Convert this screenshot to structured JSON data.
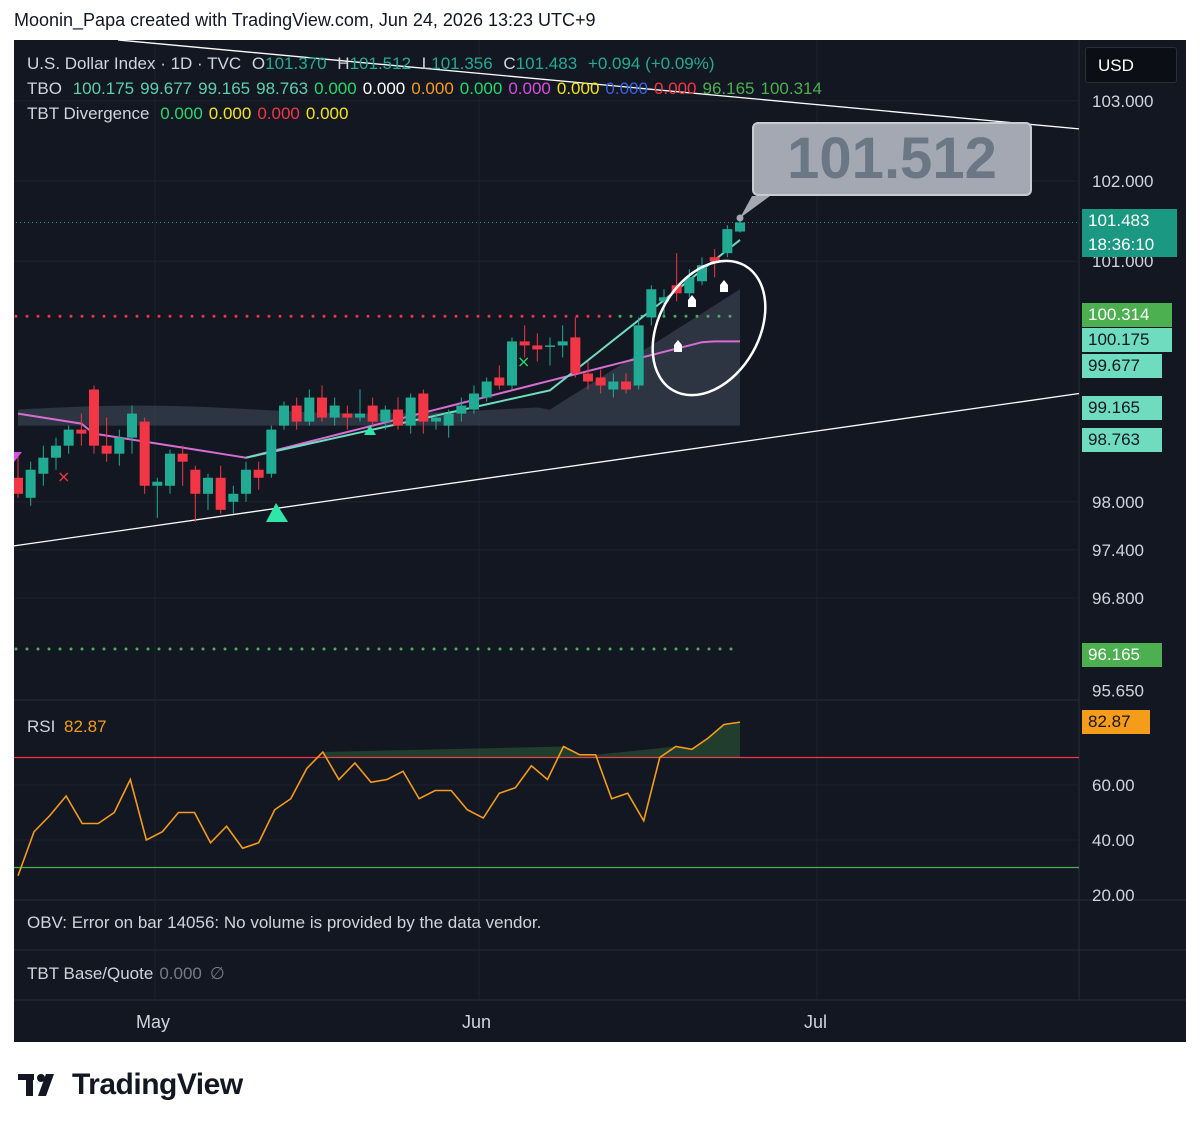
{
  "header": "Moonin_Papa created with TradingView.com, Jun 24, 2026 13:23 UTC+9",
  "currency": "USD",
  "callout_price": "101.512",
  "legend": {
    "symbol": {
      "name": "U.S. Dollar Index · 1D · TVC",
      "o_label": "O",
      "o": "101.370",
      "h_label": "H",
      "h": "101.512",
      "l_label": "L",
      "l": "101.356",
      "c_label": "C",
      "c": "101.483",
      "change": "+0.094 (+0.09%)"
    },
    "tbo": {
      "label": "TBO",
      "values": [
        {
          "v": "100.175",
          "color": "#5ecfae"
        },
        {
          "v": "99.677",
          "color": "#5ecfae"
        },
        {
          "v": "99.165",
          "color": "#5ecfae"
        },
        {
          "v": "98.763",
          "color": "#5ecfae"
        },
        {
          "v": "0.000",
          "color": "#26d96b"
        },
        {
          "v": "0.000",
          "color": "#ffffff"
        },
        {
          "v": "0.000",
          "color": "#f59c1a"
        },
        {
          "v": "0.000",
          "color": "#26d96b"
        },
        {
          "v": "0.000",
          "color": "#d64fe0"
        },
        {
          "v": "0.000",
          "color": "#f5e31a"
        },
        {
          "v": "0.000",
          "color": "#3a63e0"
        },
        {
          "v": "0.000",
          "color": "#f23645"
        },
        {
          "v": "96.165",
          "color": "#4caf50"
        },
        {
          "v": "100.314",
          "color": "#4caf50"
        }
      ]
    },
    "tbt_divergence": {
      "label": "TBT Divergence",
      "values": [
        {
          "v": "0.000",
          "color": "#26d96b"
        },
        {
          "v": "0.000",
          "color": "#f5e31a"
        },
        {
          "v": "0.000",
          "color": "#f23645"
        },
        {
          "v": "0.000",
          "color": "#f5e31a"
        }
      ]
    }
  },
  "price_axis": [
    "103.000",
    "102.000",
    "101.000",
    "98.000",
    "97.400",
    "96.800",
    "95.650"
  ],
  "price_badges": [
    {
      "id": "last",
      "text": "101.483",
      "sub": "18:36:10",
      "color": "#1a9882"
    },
    {
      "id": "b1",
      "text": "100.314",
      "color": "#4caf50"
    },
    {
      "id": "b2",
      "text": "100.175",
      "color": "#6fdcc0"
    },
    {
      "id": "b3",
      "text": "99.677",
      "color": "#6fdcc0"
    },
    {
      "id": "b4",
      "text": "99.165",
      "color": "#6fdcc0"
    },
    {
      "id": "b5",
      "text": "98.763",
      "color": "#6fdcc0"
    },
    {
      "id": "b6",
      "text": "96.165",
      "color": "#4caf50"
    }
  ],
  "rsi": {
    "label": "RSI",
    "value": "82.87",
    "axis": [
      "60.00",
      "40.00",
      "20.00"
    ],
    "upper_level": 70,
    "lower_level": 30
  },
  "obv_note": "OBV: Error on bar 14056: No volume is provided by the data vendor.",
  "tbt_base": {
    "label": "TBT Base/Quote",
    "value": "0.000",
    "icon": "∅"
  },
  "months": [
    "May",
    "Jun",
    "Jul"
  ],
  "brand": "TradingView",
  "chart_data": {
    "type": "candlestick",
    "title": "U.S. Dollar Index · 1D · TVC",
    "y_range": [
      95.6,
      103.6
    ],
    "candles": [
      {
        "o": 98.3,
        "h": 98.6,
        "l": 98.05,
        "c": 98.1
      },
      {
        "o": 98.05,
        "h": 98.5,
        "l": 97.95,
        "c": 98.4
      },
      {
        "o": 98.35,
        "h": 98.7,
        "l": 98.2,
        "c": 98.55
      },
      {
        "o": 98.55,
        "h": 98.8,
        "l": 98.4,
        "c": 98.7
      },
      {
        "o": 98.7,
        "h": 98.95,
        "l": 98.6,
        "c": 98.9
      },
      {
        "o": 98.9,
        "h": 99.1,
        "l": 98.7,
        "c": 98.85
      },
      {
        "o": 99.4,
        "h": 99.45,
        "l": 98.6,
        "c": 98.7
      },
      {
        "o": 98.7,
        "h": 99.05,
        "l": 98.5,
        "c": 98.6
      },
      {
        "o": 98.6,
        "h": 98.9,
        "l": 98.45,
        "c": 98.8
      },
      {
        "o": 98.8,
        "h": 99.2,
        "l": 98.6,
        "c": 99.1
      },
      {
        "o": 99.0,
        "h": 99.05,
        "l": 98.1,
        "c": 98.2
      },
      {
        "o": 98.2,
        "h": 98.3,
        "l": 97.8,
        "c": 98.25
      },
      {
        "o": 98.2,
        "h": 98.65,
        "l": 98.1,
        "c": 98.6
      },
      {
        "o": 98.6,
        "h": 98.7,
        "l": 98.2,
        "c": 98.5
      },
      {
        "o": 98.4,
        "h": 98.45,
        "l": 97.75,
        "c": 98.1
      },
      {
        "o": 98.1,
        "h": 98.35,
        "l": 97.9,
        "c": 98.3
      },
      {
        "o": 98.3,
        "h": 98.45,
        "l": 97.85,
        "c": 97.9
      },
      {
        "o": 98.0,
        "h": 98.2,
        "l": 97.85,
        "c": 98.1
      },
      {
        "o": 98.1,
        "h": 98.5,
        "l": 98.0,
        "c": 98.4
      },
      {
        "o": 98.4,
        "h": 98.5,
        "l": 98.15,
        "c": 98.3
      },
      {
        "o": 98.35,
        "h": 98.95,
        "l": 98.3,
        "c": 98.9
      },
      {
        "o": 98.95,
        "h": 99.25,
        "l": 98.9,
        "c": 99.2
      },
      {
        "o": 99.2,
        "h": 99.3,
        "l": 98.9,
        "c": 99.0
      },
      {
        "o": 99.0,
        "h": 99.4,
        "l": 98.95,
        "c": 99.3
      },
      {
        "o": 99.3,
        "h": 99.45,
        "l": 99.0,
        "c": 99.05
      },
      {
        "o": 99.05,
        "h": 99.3,
        "l": 98.95,
        "c": 99.2
      },
      {
        "o": 99.1,
        "h": 99.2,
        "l": 98.9,
        "c": 99.05
      },
      {
        "o": 99.05,
        "h": 99.4,
        "l": 99.0,
        "c": 99.1
      },
      {
        "o": 99.2,
        "h": 99.3,
        "l": 98.95,
        "c": 99.0
      },
      {
        "o": 99.0,
        "h": 99.2,
        "l": 98.9,
        "c": 99.15
      },
      {
        "o": 99.15,
        "h": 99.3,
        "l": 98.9,
        "c": 98.95
      },
      {
        "o": 98.95,
        "h": 99.35,
        "l": 98.85,
        "c": 99.3
      },
      {
        "o": 99.35,
        "h": 99.4,
        "l": 98.85,
        "c": 99.0
      },
      {
        "o": 99.0,
        "h": 99.1,
        "l": 98.9,
        "c": 99.05
      },
      {
        "o": 98.95,
        "h": 99.15,
        "l": 98.8,
        "c": 99.1
      },
      {
        "o": 99.1,
        "h": 99.3,
        "l": 99.0,
        "c": 99.2
      },
      {
        "o": 99.15,
        "h": 99.45,
        "l": 99.1,
        "c": 99.35
      },
      {
        "o": 99.3,
        "h": 99.55,
        "l": 99.25,
        "c": 99.5
      },
      {
        "o": 99.55,
        "h": 99.7,
        "l": 99.4,
        "c": 99.45
      },
      {
        "o": 99.45,
        "h": 100.05,
        "l": 99.4,
        "c": 100.0
      },
      {
        "o": 100.0,
        "h": 100.2,
        "l": 99.8,
        "c": 99.95
      },
      {
        "o": 99.95,
        "h": 100.1,
        "l": 99.75,
        "c": 99.9
      },
      {
        "o": 99.95,
        "h": 100.05,
        "l": 99.7,
        "c": 99.95
      },
      {
        "o": 99.95,
        "h": 100.2,
        "l": 99.8,
        "c": 100.0
      },
      {
        "o": 100.05,
        "h": 100.3,
        "l": 99.55,
        "c": 99.6
      },
      {
        "o": 99.6,
        "h": 99.75,
        "l": 99.4,
        "c": 99.5
      },
      {
        "o": 99.55,
        "h": 99.65,
        "l": 99.35,
        "c": 99.45
      },
      {
        "o": 99.4,
        "h": 99.6,
        "l": 99.3,
        "c": 99.5
      },
      {
        "o": 99.5,
        "h": 99.6,
        "l": 99.35,
        "c": 99.4
      },
      {
        "o": 99.45,
        "h": 100.3,
        "l": 99.4,
        "c": 100.2
      },
      {
        "o": 100.3,
        "h": 100.7,
        "l": 100.2,
        "c": 100.65
      },
      {
        "o": 100.5,
        "h": 100.65,
        "l": 100.3,
        "c": 100.55
      },
      {
        "o": 100.7,
        "h": 101.1,
        "l": 100.5,
        "c": 100.6
      },
      {
        "o": 100.6,
        "h": 100.9,
        "l": 100.55,
        "c": 100.8
      },
      {
        "o": 100.75,
        "h": 101.05,
        "l": 100.7,
        "c": 100.95
      },
      {
        "o": 101.05,
        "h": 101.15,
        "l": 100.8,
        "c": 101.0
      },
      {
        "o": 101.1,
        "h": 101.45,
        "l": 101.05,
        "c": 101.4
      },
      {
        "o": 101.37,
        "h": 101.512,
        "l": 101.356,
        "c": 101.483
      }
    ],
    "rsi_values": [
      27,
      43,
      49,
      56,
      46,
      46,
      50,
      62,
      40,
      43,
      50,
      50,
      39,
      45,
      37,
      39,
      51,
      55,
      66,
      72,
      62,
      68,
      61,
      62,
      65,
      55,
      58,
      58,
      51,
      48,
      57,
      59,
      67,
      62,
      74,
      71,
      71,
      55,
      57,
      47,
      70,
      74,
      73,
      77,
      82,
      82.87
    ]
  }
}
